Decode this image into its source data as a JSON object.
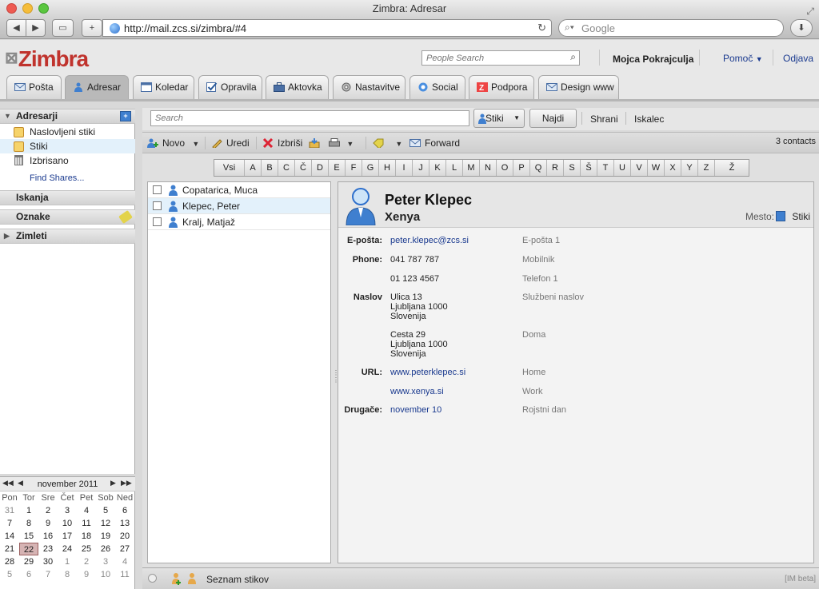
{
  "window": {
    "title": "Zimbra: Adresar"
  },
  "browser": {
    "url": "http://mail.zcs.si/zimbra/#4",
    "search_placeholder": "Google"
  },
  "header": {
    "logo": "Zimbra",
    "people_search_placeholder": "People Search",
    "user": "Mojca Pokrajculja",
    "help": "Pomoč",
    "logout": "Odjava"
  },
  "tabs": [
    {
      "label": "Pošta",
      "icon": "mail-icon"
    },
    {
      "label": "Adresar",
      "icon": "contacts-icon",
      "active": true
    },
    {
      "label": "Koledar",
      "icon": "calendar-icon"
    },
    {
      "label": "Opravila",
      "icon": "tasks-icon"
    },
    {
      "label": "Aktovka",
      "icon": "briefcase-icon"
    },
    {
      "label": "Nastavitve",
      "icon": "gear-icon"
    },
    {
      "label": "Social",
      "icon": "social-icon"
    },
    {
      "label": "Podpora",
      "icon": "support-icon"
    },
    {
      "label": "Design www",
      "icon": "design-icon"
    }
  ],
  "sidebar": {
    "addressbooks_header": "Adresarji",
    "items": [
      {
        "label": "Naslovljeni stiki"
      },
      {
        "label": "Stiki",
        "selected": true
      },
      {
        "label": "Izbrisano"
      }
    ],
    "find_shares": "Find Shares...",
    "searches_header": "Iskanja",
    "tags_header": "Oznake",
    "zimlets_header": "Zimleti"
  },
  "calendar": {
    "month": "november 2011",
    "weekdays": [
      "Pon",
      "Tor",
      "Sre",
      "Čet",
      "Pet",
      "Sob",
      "Ned"
    ],
    "weeks": [
      [
        "31",
        "1",
        "2",
        "3",
        "4",
        "5",
        "6"
      ],
      [
        "7",
        "8",
        "9",
        "10",
        "11",
        "12",
        "13"
      ],
      [
        "14",
        "15",
        "16",
        "17",
        "18",
        "19",
        "20"
      ],
      [
        "21",
        "22",
        "23",
        "24",
        "25",
        "26",
        "27"
      ],
      [
        "28",
        "29",
        "30",
        "1",
        "2",
        "3",
        "4"
      ],
      [
        "5",
        "6",
        "7",
        "8",
        "9",
        "10",
        "11"
      ]
    ],
    "today": "22"
  },
  "search": {
    "placeholder": "Search",
    "type": "Stiki",
    "find": "Najdi",
    "save": "Shrani",
    "advanced": "Iskalec"
  },
  "toolbar": {
    "new": "Novo",
    "edit": "Uredi",
    "delete": "Izbriši",
    "forward": "Forward",
    "count": "3 contacts"
  },
  "alphabet": [
    "Vsi",
    "A",
    "B",
    "C",
    "Č",
    "D",
    "E",
    "F",
    "G",
    "H",
    "I",
    "J",
    "K",
    "L",
    "M",
    "N",
    "O",
    "P",
    "Q",
    "R",
    "S",
    "Š",
    "T",
    "U",
    "V",
    "W",
    "X",
    "Y",
    "Z",
    "Ž"
  ],
  "contacts": [
    {
      "name": "Copatarica, Muca"
    },
    {
      "name": "Klepec, Peter",
      "selected": true
    },
    {
      "name": "Kralj, Matjaž"
    }
  ],
  "detail": {
    "name": "Peter Klepec",
    "company": "Xenya",
    "location_label": "Mesto:",
    "location_value": "Stiki",
    "email_label": "E-pošta:",
    "email": "peter.klepec@zcs.si",
    "email_type": "E-pošta 1",
    "phone_label": "Phone:",
    "phone1": "041 787 787",
    "phone1_type": "Mobilnik",
    "phone2": "01 123 4567",
    "phone2_type": "Telefon 1",
    "address_label": "Naslov",
    "address1": [
      "Ulica 13",
      "Ljubljana 1000",
      "Slovenija"
    ],
    "address1_type": "Službeni naslov",
    "address2": [
      "Cesta 29",
      "Ljubljana 1000",
      "Slovenija"
    ],
    "address2_type": "Doma",
    "url_label": "URL:",
    "url1": "www.peterklepec.si",
    "url1_type": "Home",
    "url2": "www.xenya.si",
    "url2_type": "Work",
    "other_label": "Drugače:",
    "other": "november 10",
    "other_type": "Rojstni dan"
  },
  "statusbar": {
    "buddy_list": "Seznam stikov",
    "im": "[IM beta]"
  }
}
